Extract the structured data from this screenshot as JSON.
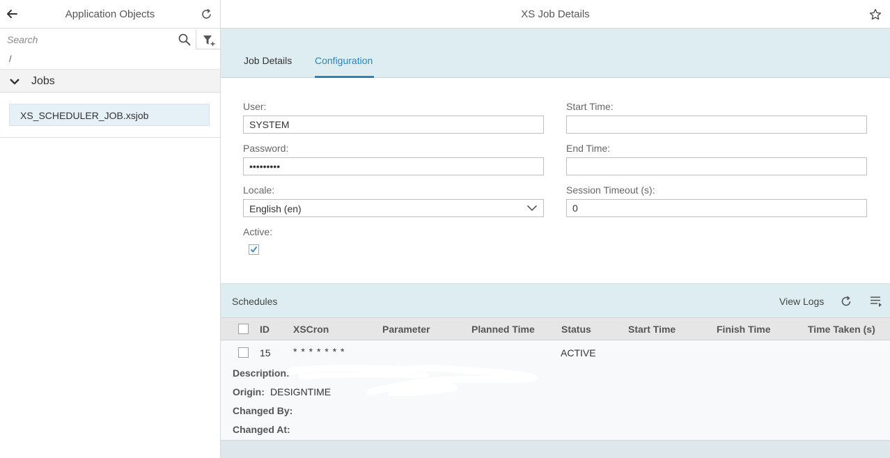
{
  "left_pane": {
    "title": "Application Objects",
    "search": {
      "placeholder": "Search",
      "value": ""
    },
    "path": "/",
    "group": {
      "label": "Jobs",
      "expanded": true
    },
    "items": [
      {
        "label": "XS_SCHEDULER_JOB.xsjob",
        "selected": true
      }
    ]
  },
  "right_pane": {
    "title": "XS Job Details",
    "tabs": [
      {
        "label": "Job Details",
        "active": false
      },
      {
        "label": "Configuration",
        "active": true
      }
    ],
    "form": {
      "user": {
        "label": "User:",
        "value": "SYSTEM"
      },
      "password": {
        "label": "Password:",
        "value": "passwordx"
      },
      "locale": {
        "label": "Locale:",
        "value": "English (en)"
      },
      "active": {
        "label": "Active:",
        "checked": true
      },
      "start_time": {
        "label": "Start Time:",
        "value": ""
      },
      "end_time": {
        "label": "End Time:",
        "value": ""
      },
      "session_timeout": {
        "label": "Session Timeout (s):",
        "value": "0"
      }
    },
    "schedules": {
      "title": "Schedules",
      "view_logs_label": "View Logs",
      "columns": [
        "ID",
        "XSCron",
        "Parameter",
        "Planned Time",
        "Status",
        "Start Time",
        "Finish Time",
        "Time Taken (s)"
      ],
      "rows": [
        {
          "id": "15",
          "xscron": "* * * * * * *",
          "parameter": "",
          "planned_time": "",
          "status": "ACTIVE",
          "start_time": "",
          "finish_time": "",
          "time_taken": "",
          "details": {
            "description_label": "Description:",
            "origin_label": "Origin:",
            "origin_value": "DESIGNTIME",
            "changed_by_label": "Changed By:",
            "changed_at_label": "Changed At:"
          }
        }
      ]
    }
  },
  "colors": {
    "accent": "#2a84b9",
    "header_band": "#ddedf2",
    "selected_item": "#e6f0f7"
  },
  "icons": [
    "back-arrow-icon",
    "refresh-icon",
    "search-icon",
    "filter-icon",
    "chevron-down-icon",
    "star-icon",
    "checkmark-icon",
    "menu-icon"
  ]
}
